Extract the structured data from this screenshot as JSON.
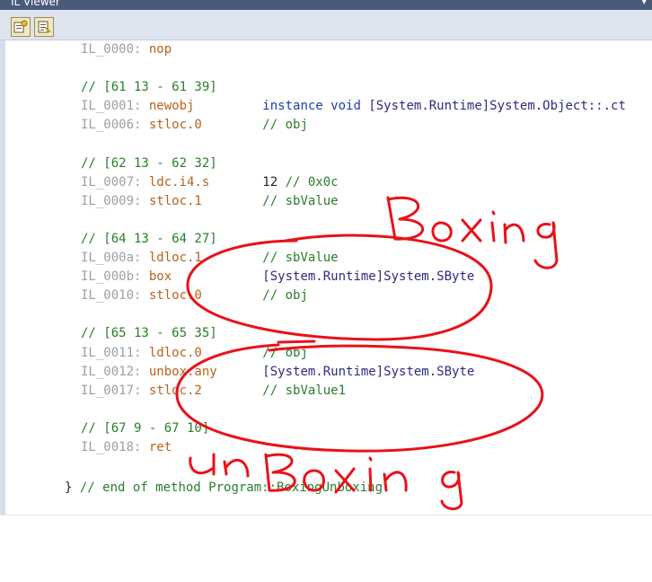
{
  "window": {
    "title": "IL Viewer",
    "pin_icon": "pin-icon"
  },
  "toolbar": {
    "buttons": [
      {
        "icon": "view-il-icon"
      },
      {
        "icon": "view-decompiled-icon"
      }
    ]
  },
  "code": {
    "lines": [
      {
        "label": "IL_0000:",
        "op": "nop",
        "arg": "",
        "comment": ""
      },
      {
        "comment_only": "// [61 13 - 61 39]"
      },
      {
        "label": "IL_0001:",
        "op": "newobj",
        "kw": "instance void",
        "arg": "[System.Runtime]System.Object::.ct",
        "comment": ""
      },
      {
        "label": "IL_0006:",
        "op": "stloc.0",
        "arg": "",
        "comment": "// obj"
      },
      {
        "comment_only": "// [62 13 - 62 32]"
      },
      {
        "label": "IL_0007:",
        "op": "ldc.i4.s",
        "arg": "12",
        "comment": "// 0x0c"
      },
      {
        "label": "IL_0009:",
        "op": "stloc.1",
        "arg": "",
        "comment": "// sbValue"
      },
      {
        "comment_only": "// [64 13 - 64 27]"
      },
      {
        "label": "IL_000a:",
        "op": "ldloc.1",
        "arg": "",
        "comment": "// sbValue"
      },
      {
        "label": "IL_000b:",
        "op": "box",
        "arg": "[System.Runtime]System.SByte",
        "comment": ""
      },
      {
        "label": "IL_0010:",
        "op": "stloc.0",
        "arg": "",
        "comment": "// obj"
      },
      {
        "comment_only": "// [65 13 - 65 35]"
      },
      {
        "label": "IL_0011:",
        "op": "ldloc.0",
        "arg": "",
        "comment": "// obj"
      },
      {
        "label": "IL_0012:",
        "op": "unbox.any",
        "arg": "[System.Runtime]System.SByte",
        "comment": ""
      },
      {
        "label": "IL_0017:",
        "op": "stloc.2",
        "arg": "",
        "comment": "// sbValue1"
      },
      {
        "comment_only": "// [67 9 - 67 10]"
      },
      {
        "label": "IL_0018:",
        "op": "ret",
        "arg": "",
        "comment": ""
      }
    ],
    "end_brace": "}",
    "end_comment": "// end of method Program::BoxingUnboxing"
  },
  "annotations": {
    "top_label": "Boxing",
    "bottom_label": "UnBoxing",
    "ink_color": "#e8121a"
  }
}
